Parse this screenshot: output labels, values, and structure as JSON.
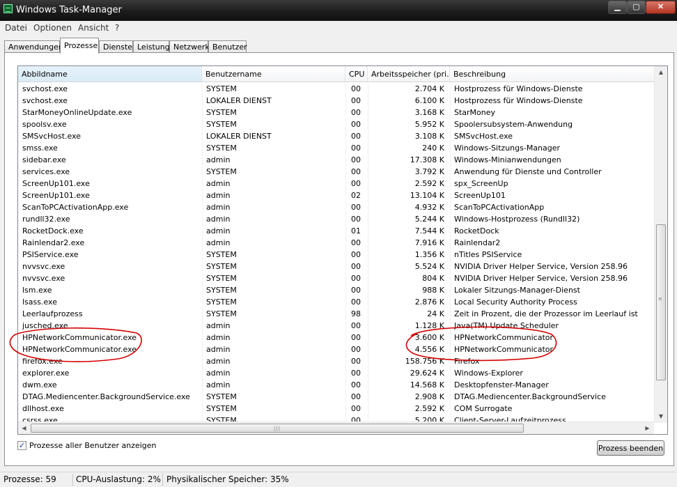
{
  "window": {
    "title": "Windows Task-Manager",
    "min_glyph": "▁",
    "max_glyph": "▢",
    "close_glyph": "✕"
  },
  "menu": [
    "Datei",
    "Optionen",
    "Ansicht",
    "?"
  ],
  "tabs": [
    "Anwendungen",
    "Prozesse",
    "Dienste",
    "Leistung",
    "Netzwerk",
    "Benutzer"
  ],
  "columns": [
    "Abbildname",
    "Benutzername",
    "CPU",
    "Arbeitsspeicher (pri...",
    "Beschreibung"
  ],
  "rows": [
    {
      "name": "svchost.exe",
      "user": "SYSTEM",
      "cpu": "00",
      "mem": "2.704 K",
      "desc": "Hostprozess für Windows-Dienste"
    },
    {
      "name": "svchost.exe",
      "user": "LOKALER DIENST",
      "cpu": "00",
      "mem": "6.100 K",
      "desc": "Hostprozess für Windows-Dienste"
    },
    {
      "name": "StarMoneyOnlineUpdate.exe",
      "user": "SYSTEM",
      "cpu": "00",
      "mem": "3.168 K",
      "desc": "StarMoney"
    },
    {
      "name": "spoolsv.exe",
      "user": "SYSTEM",
      "cpu": "00",
      "mem": "5.952 K",
      "desc": "Spoolersubsystem-Anwendung"
    },
    {
      "name": "SMSvcHost.exe",
      "user": "LOKALER DIENST",
      "cpu": "00",
      "mem": "3.108 K",
      "desc": "SMSvcHost.exe"
    },
    {
      "name": "smss.exe",
      "user": "SYSTEM",
      "cpu": "00",
      "mem": "240 K",
      "desc": "Windows-Sitzungs-Manager"
    },
    {
      "name": "sidebar.exe",
      "user": "admin",
      "cpu": "00",
      "mem": "17.308 K",
      "desc": "Windows-Minianwendungen"
    },
    {
      "name": "services.exe",
      "user": "SYSTEM",
      "cpu": "00",
      "mem": "3.792 K",
      "desc": "Anwendung für Dienste und Controller"
    },
    {
      "name": "ScreenUp101.exe",
      "user": "admin",
      "cpu": "00",
      "mem": "2.592 K",
      "desc": "spx_ScreenUp"
    },
    {
      "name": "ScreenUp101.exe",
      "user": "admin",
      "cpu": "02",
      "mem": "13.104 K",
      "desc": "ScreenUp101"
    },
    {
      "name": "ScanToPCActivationApp.exe",
      "user": "admin",
      "cpu": "00",
      "mem": "4.932 K",
      "desc": "ScanToPCActivationApp"
    },
    {
      "name": "rundll32.exe",
      "user": "admin",
      "cpu": "00",
      "mem": "5.244 K",
      "desc": "Windows-Hostprozess (Rundll32)"
    },
    {
      "name": "RocketDock.exe",
      "user": "admin",
      "cpu": "01",
      "mem": "7.544 K",
      "desc": "RocketDock"
    },
    {
      "name": "Rainlendar2.exe",
      "user": "admin",
      "cpu": "00",
      "mem": "7.916 K",
      "desc": "Rainlendar2"
    },
    {
      "name": "PSIService.exe",
      "user": "SYSTEM",
      "cpu": "00",
      "mem": "1.356 K",
      "desc": "nTitles PSIService"
    },
    {
      "name": "nvvsvc.exe",
      "user": "SYSTEM",
      "cpu": "00",
      "mem": "5.524 K",
      "desc": "NVIDIA Driver Helper Service, Version 258.96"
    },
    {
      "name": "nvvsvc.exe",
      "user": "SYSTEM",
      "cpu": "00",
      "mem": "804 K",
      "desc": "NVIDIA Driver Helper Service, Version 258.96"
    },
    {
      "name": "lsm.exe",
      "user": "SYSTEM",
      "cpu": "00",
      "mem": "988 K",
      "desc": "Lokaler Sitzungs-Manager-Dienst"
    },
    {
      "name": "lsass.exe",
      "user": "SYSTEM",
      "cpu": "00",
      "mem": "2.876 K",
      "desc": "Local Security Authority Process"
    },
    {
      "name": "Leerlaufprozess",
      "user": "SYSTEM",
      "cpu": "98",
      "mem": "24 K",
      "desc": "Zeit in Prozent, die der Prozessor im Leerlauf ist"
    },
    {
      "name": "jusched.exe",
      "user": "admin",
      "cpu": "00",
      "mem": "1.128 K",
      "desc": "Java(TM) Update Scheduler"
    },
    {
      "name": "HPNetworkCommunicator.exe",
      "user": "admin",
      "cpu": "00",
      "mem": "3.600 K",
      "desc": "HPNetworkCommunicator"
    },
    {
      "name": "HPNetworkCommunicator.exe",
      "user": "admin",
      "cpu": "00",
      "mem": "4.556 K",
      "desc": "HPNetworkCommunicator"
    },
    {
      "name": "firefox.exe",
      "user": "admin",
      "cpu": "00",
      "mem": "158.756 K",
      "desc": "Firefox"
    },
    {
      "name": "explorer.exe",
      "user": "admin",
      "cpu": "00",
      "mem": "29.624 K",
      "desc": "Windows-Explorer"
    },
    {
      "name": "dwm.exe",
      "user": "admin",
      "cpu": "00",
      "mem": "14.568 K",
      "desc": "Desktopfenster-Manager"
    },
    {
      "name": "DTAG.Mediencenter.BackgroundService.exe",
      "user": "SYSTEM",
      "cpu": "00",
      "mem": "2.908 K",
      "desc": "DTAG.Mediencenter.BackgroundService"
    },
    {
      "name": "dllhost.exe",
      "user": "SYSTEM",
      "cpu": "00",
      "mem": "2.592 K",
      "desc": "COM Surrogate"
    },
    {
      "name": "csrss.exe",
      "user": "SYSTEM",
      "cpu": "00",
      "mem": "5.200 K",
      "desc": "Client-Server-Laufzeitprozess"
    }
  ],
  "checkbox": {
    "label": "Prozesse aller Benutzer anzeigen",
    "checked_glyph": "✓"
  },
  "end_button": "Prozess beenden",
  "status": [
    "Prozesse: 59",
    "CPU-Auslastung: 2%",
    "Physikalischer Speicher: 35%"
  ],
  "annotation_color": "#d40000",
  "highlighted_rows": [
    21,
    22
  ]
}
